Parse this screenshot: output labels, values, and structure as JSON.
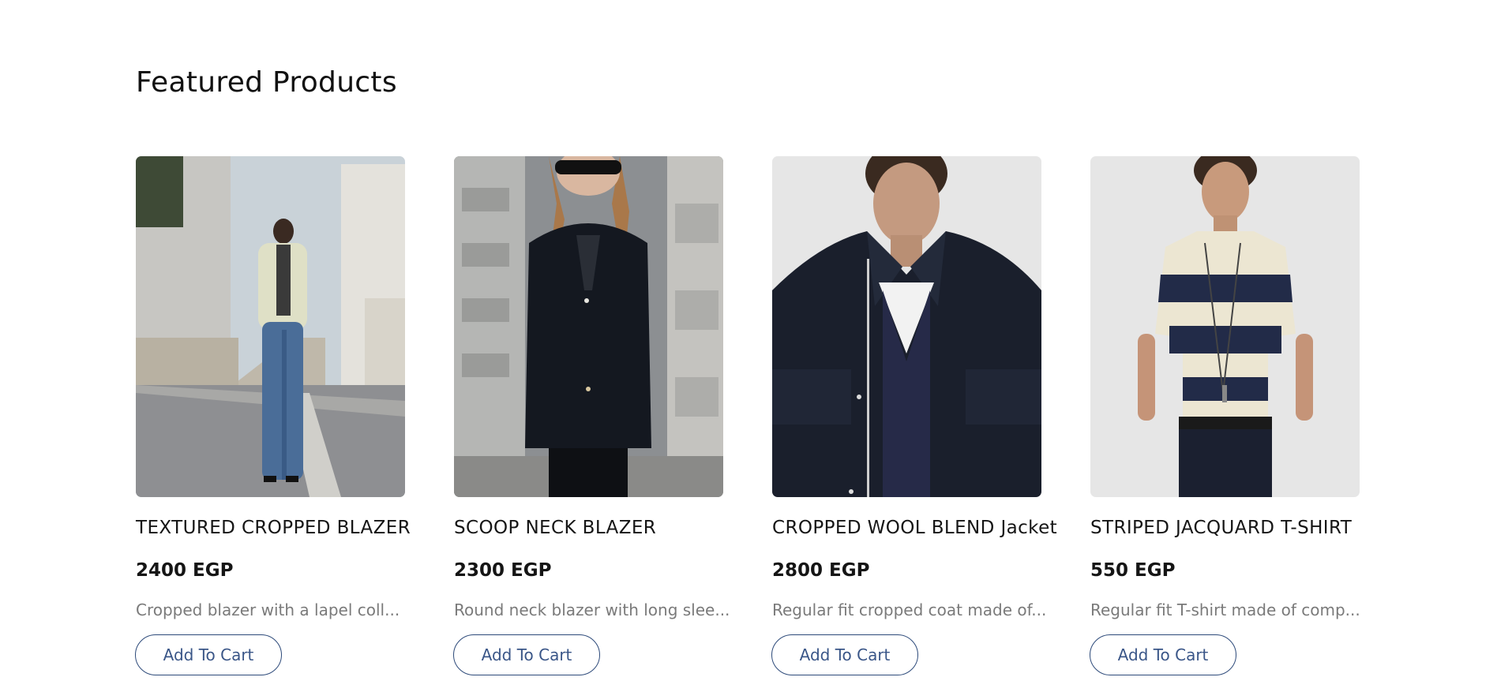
{
  "section": {
    "title": "Featured Products"
  },
  "products": [
    {
      "name": "TEXTURED CROPPED BLAZER",
      "price": "2400 EGP",
      "description": "Cropped blazer with a lapel coll...",
      "button_label": "Add To Cart"
    },
    {
      "name": "SCOOP NECK BLAZER",
      "price": "2300 EGP",
      "description": "Round neck blazer with long slee...",
      "button_label": "Add To Cart"
    },
    {
      "name": "CROPPED WOOL BLEND Jacket",
      "price": "2800 EGP",
      "description": "Regular fit cropped coat made of...",
      "button_label": "Add To Cart"
    },
    {
      "name": "STRIPED JACQUARD T-SHIRT",
      "price": "550 EGP",
      "description": "Regular fit T-shirt made of comp...",
      "button_label": "Add To Cart"
    }
  ],
  "colors": {
    "button_border": "#2d4a7a",
    "button_text": "#3a5688",
    "description_text": "#7a7a7a"
  }
}
